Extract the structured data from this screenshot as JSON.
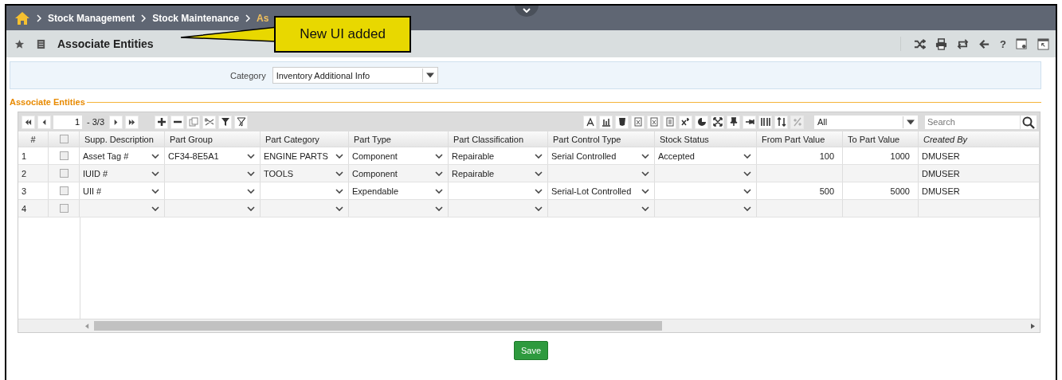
{
  "breadcrumb": [
    "Stock Management",
    "Stock Maintenance",
    "As"
  ],
  "callout": {
    "text": "New UI added"
  },
  "page": {
    "title": "Associate Entities",
    "actions": [
      "?"
    ]
  },
  "filter": {
    "label": "Category",
    "value": "Inventory Additional Info"
  },
  "section": {
    "title": "Associate Entities"
  },
  "pager": {
    "page": "1",
    "range": "- 3/3"
  },
  "view_select": {
    "value": "All"
  },
  "search": {
    "placeholder": "Search"
  },
  "table": {
    "header_checked": false,
    "columns": [
      {
        "label": "#",
        "kind": "index",
        "italic": false
      },
      {
        "kind": "check"
      },
      {
        "label": "Supp. Description",
        "kind": "select",
        "italic": false
      },
      {
        "label": "Part Group",
        "kind": "select",
        "italic": false
      },
      {
        "label": "Part Category",
        "kind": "select",
        "italic": false
      },
      {
        "label": "Part Type",
        "kind": "select",
        "italic": false
      },
      {
        "label": "Part Classification",
        "kind": "select",
        "italic": false
      },
      {
        "label": "Part Control Type",
        "kind": "select",
        "italic": false
      },
      {
        "label": "Stock Status",
        "kind": "select",
        "italic": false
      },
      {
        "label": "From Part Value",
        "kind": "number",
        "italic": false
      },
      {
        "label": "To Part Value",
        "kind": "number",
        "italic": false
      },
      {
        "label": "Created By",
        "kind": "text",
        "italic": true
      }
    ],
    "rows": [
      {
        "checked": false,
        "cells": [
          "1",
          "",
          "Asset Tag #",
          "CF34-8E5A1",
          "ENGINE PARTS",
          "Component",
          "Repairable",
          "Serial Controlled",
          "Accepted",
          "100",
          "1000",
          "DMUSER"
        ]
      },
      {
        "checked": false,
        "cells": [
          "2",
          "",
          "IUID #",
          "",
          "TOOLS",
          "Component",
          "Repairable",
          "",
          "",
          "",
          "",
          "DMUSER"
        ]
      },
      {
        "checked": false,
        "cells": [
          "3",
          "",
          "UII #",
          "",
          "",
          "Expendable",
          "",
          "Serial-Lot Controlled",
          "",
          "500",
          "5000",
          "DMUSER"
        ]
      },
      {
        "checked": false,
        "cells": [
          "4",
          "",
          "",
          "",
          "",
          "",
          "",
          "",
          "",
          "",
          "",
          ""
        ]
      }
    ]
  },
  "buttons": [
    {
      "label": "Save"
    }
  ]
}
